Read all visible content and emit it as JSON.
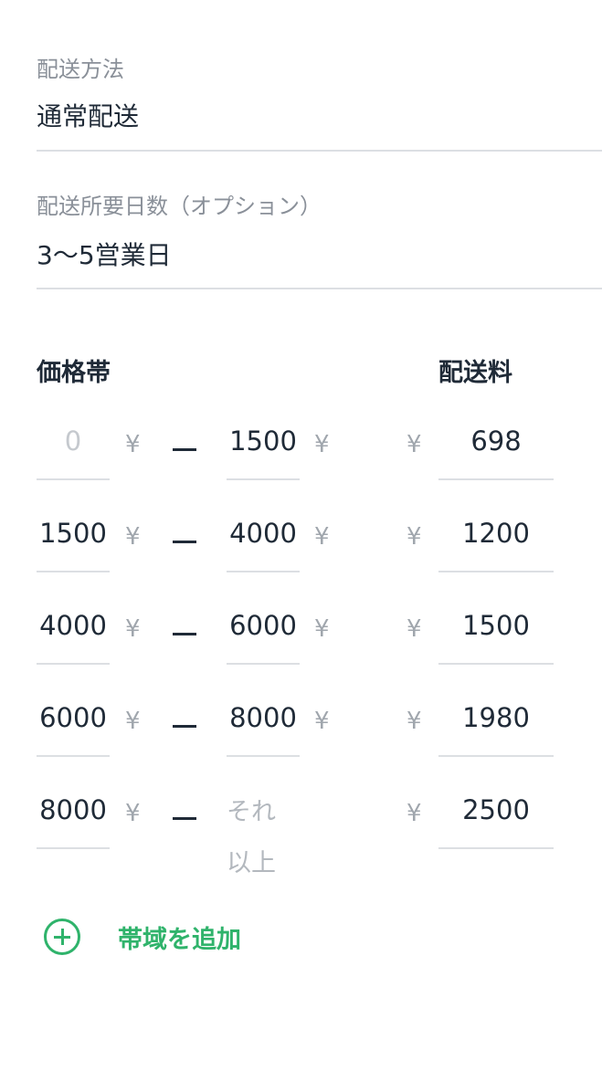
{
  "shipping_method": {
    "label": "配送方法",
    "value": "通常配送"
  },
  "delivery_days": {
    "label": "配送所要日数（オプション）",
    "value": "3〜5営業日"
  },
  "table": {
    "range_header": "価格帯",
    "fee_header": "配送料",
    "currency_symbol": "¥",
    "rows": [
      {
        "min": "0",
        "max": "1500",
        "fee": "698"
      },
      {
        "min": "1500",
        "max": "4000",
        "fee": "1200"
      },
      {
        "min": "4000",
        "max": "6000",
        "fee": "1500"
      },
      {
        "min": "6000",
        "max": "8000",
        "fee": "1980"
      },
      {
        "min": "8000",
        "max": "それ以上",
        "fee": "2500"
      }
    ]
  },
  "add_band": {
    "label": "帯域を追加",
    "icon": "plus-circle-icon",
    "color": "#2fb36b"
  }
}
